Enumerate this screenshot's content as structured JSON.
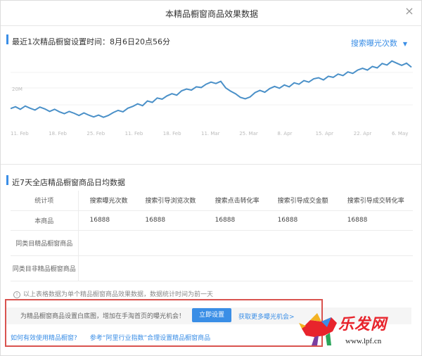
{
  "modal": {
    "title": "本精品橱窗商品效果数据",
    "close_icon": "×"
  },
  "section1": {
    "title": "最近1次精品橱窗设置时间：8月6日20点56分",
    "metric_select": "搜索曝光次数",
    "caret": "▼"
  },
  "chart_data": {
    "type": "line",
    "title": "",
    "xlabel": "",
    "ylabel": "",
    "y_tick_label": "20M",
    "x_ticks": [
      "11. Feb",
      "18. Feb",
      "25. Feb",
      "11. Feb",
      "18. Feb",
      "11. Mar",
      "25. Mar",
      "8. Apr",
      "15. Apr",
      "22. Apr",
      "6. May"
    ],
    "grid": false,
    "legend": "none",
    "color": "#4a90c8",
    "series": [
      {
        "values": [
          17.4,
          17.9,
          17.2,
          18.1,
          17.5,
          17.0,
          17.8,
          17.3,
          16.6,
          17.2,
          16.5,
          16.0,
          16.6,
          16.1,
          15.5,
          16.2,
          15.6,
          15.1,
          15.6,
          15.0,
          15.5,
          16.3,
          16.9,
          16.5,
          17.5,
          18.0,
          18.7,
          18.2,
          19.5,
          19.1,
          20.3,
          20.0,
          20.9,
          21.5,
          21.1,
          22.3,
          22.8,
          22.5,
          23.4,
          23.2,
          24.1,
          24.7,
          24.3,
          24.9,
          23.1,
          22.2,
          21.5,
          20.5,
          20.1,
          20.6,
          21.8,
          22.4,
          21.9,
          22.9,
          23.5,
          23.0,
          23.9,
          23.4,
          24.5,
          24.1,
          25.1,
          24.7,
          25.6,
          25.9,
          25.3,
          26.3,
          26.0,
          26.9,
          26.5,
          27.5,
          27.1,
          28.0,
          28.5,
          28.0,
          29.0,
          28.6,
          29.8,
          29.4,
          30.5,
          29.9,
          29.3,
          29.9,
          28.8
        ]
      }
    ]
  },
  "section2": {
    "title": "近7天全店精品橱窗商品日均数据",
    "headers": [
      "统计项",
      "搜索曝光次数",
      "搜索引导浏览次数",
      "搜索点击转化率",
      "搜索引导成交金额",
      "搜索引导成交转化率"
    ],
    "rows": [
      {
        "label": "本商品",
        "values": [
          "16888",
          "16888",
          "16888",
          "16888",
          "16888"
        ]
      },
      {
        "label": "同类目精品橱窗商品",
        "values": [
          "",
          "",
          "",
          "",
          ""
        ]
      },
      {
        "label": "同类目非精品橱窗商品",
        "values": [
          "",
          "",
          "",
          "",
          ""
        ]
      }
    ],
    "note": "以上表格数据为单个精品橱窗商品效果数据，数据统计时间为前一天",
    "info_icon": "!"
  },
  "promo": {
    "text": "为精品橱窗商品设置白底图，增加在手淘首页的曝光机会！",
    "button": "立即设置",
    "more_link": "获取更多曝光机会>"
  },
  "footer": {
    "link1": "如何有效使用精品橱窗?",
    "link2": "参考“阿里行业指数”合理设置精品橱窗商品"
  },
  "watermark": {
    "text": "乐发网",
    "url": "www.lpf.cn"
  }
}
